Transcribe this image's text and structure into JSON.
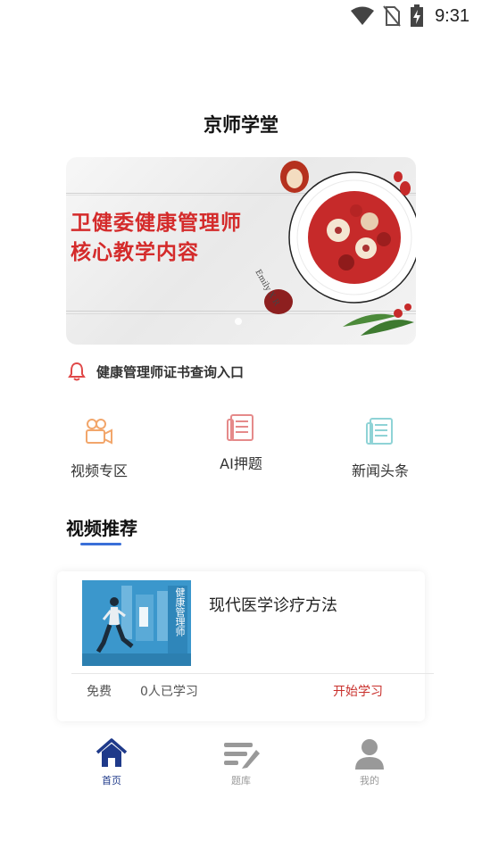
{
  "status_bar": {
    "time": "9:31",
    "icons": [
      "wifi-icon",
      "no-sim-icon",
      "battery-charging-icon"
    ]
  },
  "app_title": "京师学堂",
  "banner": {
    "line1": "卫健委健康管理师",
    "line2": "核心教学内容",
    "watermark": "Emily X R",
    "accent_color": "#d42b2b"
  },
  "notice": {
    "text": "健康管理师证书查询入口",
    "icon": "bell-icon"
  },
  "menu": [
    {
      "label": "视频专区",
      "icon": "video-camera-icon"
    },
    {
      "label": "AI押题",
      "icon": "document-icon"
    },
    {
      "label": "新闻头条",
      "icon": "newspaper-icon"
    }
  ],
  "section": {
    "title": "视频推荐",
    "underline_color": "#3a6fd8"
  },
  "course": {
    "title": "现代医学诊疗方法",
    "thumb_text": "健康管理师",
    "price": "免费",
    "learners": "0人已学习",
    "action": "开始学习",
    "action_color": "#c9302c"
  },
  "bottom_nav": [
    {
      "label": "首页",
      "icon": "home-icon",
      "active": true
    },
    {
      "label": "题库",
      "icon": "question-bank-icon",
      "active": false
    },
    {
      "label": "我的",
      "icon": "profile-icon",
      "active": false
    }
  ]
}
